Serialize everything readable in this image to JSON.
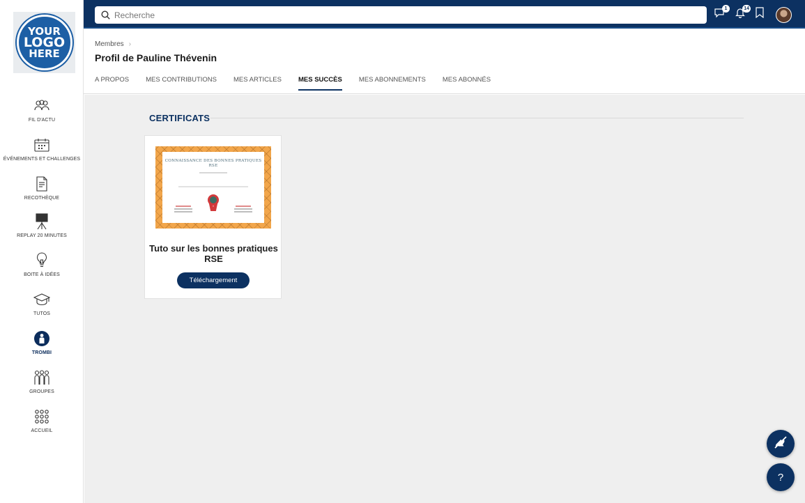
{
  "logo": {
    "line1": "YOUR",
    "line2": "LOGO",
    "line3": "HERE"
  },
  "sidebar": {
    "items": [
      {
        "label": "FIL D'ACTU",
        "icon": "people-icon"
      },
      {
        "label": "ÉVÉNEMENTS ET CHALLENGES",
        "icon": "calendar-icon"
      },
      {
        "label": "RECOTHÈQUE",
        "icon": "document-icon"
      },
      {
        "label": "REPLAY 20 MINUTES",
        "icon": "easel-icon"
      },
      {
        "label": "BOITE À IDÉES",
        "icon": "lightbulb-icon"
      },
      {
        "label": "TUTOS",
        "icon": "graduation-cap-icon"
      },
      {
        "label": "TROMBI",
        "icon": "person-icon",
        "active": true
      },
      {
        "label": "GROUPES",
        "icon": "group-icon"
      },
      {
        "label": "ACCUEIL",
        "icon": "grid-icon"
      }
    ]
  },
  "topbar": {
    "search_placeholder": "Recherche",
    "chat_badge": "1",
    "notifications_badge": "14"
  },
  "header": {
    "breadcrumb": "Membres",
    "title": "Profil de Pauline Thévenin",
    "tabs": [
      {
        "label": "A PROPOS"
      },
      {
        "label": "MES CONTRIBUTIONS"
      },
      {
        "label": "MES ARTICLES"
      },
      {
        "label": "MES SUCCÈS",
        "active": true
      },
      {
        "label": "MES ABONNEMENTS"
      },
      {
        "label": "MES ABONNÉS"
      }
    ]
  },
  "main": {
    "section_title": "CERTIFICATS",
    "certificate": {
      "image_title": "CONNAISSANCE DES BONNES PRATIQUES RSE",
      "title": "Tuto sur les bonnes pratiques RSE",
      "button_label": "Téléchargement"
    }
  },
  "colors": {
    "brand": "#0c3161",
    "certificate_border": "#f2a64b",
    "background": "#efefef"
  }
}
